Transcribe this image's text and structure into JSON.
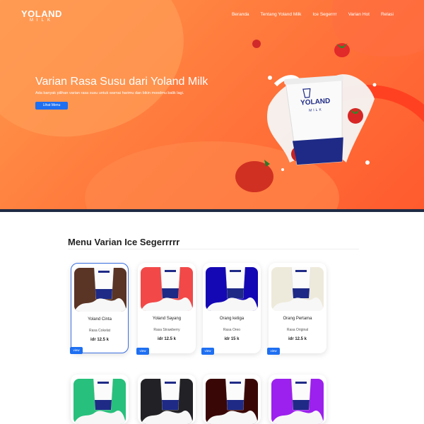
{
  "logo": {
    "main": "YOLAND",
    "sub": "MILK"
  },
  "nav": [
    "Beranda",
    "Tentang Yoland Milk",
    "Ice Segerrrr",
    "Varian Hot",
    "Relasi"
  ],
  "hero": {
    "title": "Varian Rasa Susu dari Yoland Milk",
    "subtitle": "Ada banyak pilihan varian rasa susu untuk warnai harimu dan bikin moodmu balik lagi.",
    "button": "Lihat Menu",
    "cup_brand": "YOLAND",
    "cup_sub": "MILK"
  },
  "menu": {
    "title": "Menu Varian Ice Segerrrrr",
    "view_label": "view",
    "items": [
      {
        "name": "Yoland Cinta",
        "flavor": "Rasa Cokelat",
        "price": "idr 12.5 k",
        "color": "#5a3425"
      },
      {
        "name": "Yoland Sayang",
        "flavor": "Rasa Strawberry",
        "price": "idr 12.5 k",
        "color": "#f24848"
      },
      {
        "name": "Orang ketiga",
        "flavor": "Rasa Oreo",
        "price": "idr 15 k",
        "color": "#1408b4"
      },
      {
        "name": "Orang Pertama",
        "flavor": "Rasa Original",
        "price": "idr 12.5 k",
        "color": "#eeeadb"
      }
    ],
    "row2_colors": [
      "#27c07c",
      "#222226",
      "#3a0707",
      "#9c20ee"
    ]
  }
}
